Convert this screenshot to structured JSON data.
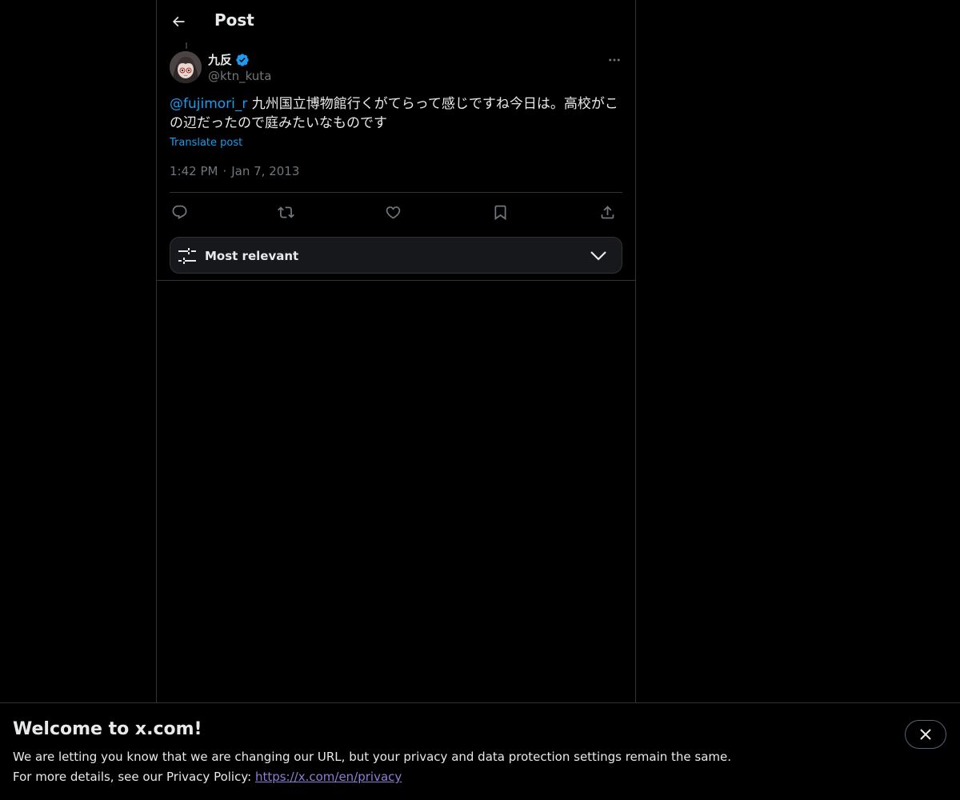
{
  "header": {
    "title": "Post",
    "back_icon": "arrow-left-icon"
  },
  "post": {
    "author": {
      "display_name": "九反",
      "verified": true,
      "handle": "@ktn_kuta"
    },
    "mention": "@fujimori_r",
    "text": " 九州国立博物館行くがてらって感じですね今日は。高校がこの辺だったので庭みたいなものです",
    "translate_label": "Translate post",
    "time": "1:42 PM",
    "separator": "·",
    "date": "Jan 7, 2013",
    "action_icons": [
      "reply-icon",
      "repost-icon",
      "like-icon",
      "bookmark-icon",
      "share-icon"
    ]
  },
  "sort": {
    "label": "Most relevant",
    "icon": "sliders-icon",
    "chevron": "chevron-down-icon"
  },
  "banner": {
    "title": "Welcome to x.com!",
    "line1": "We are letting you know that we are changing our URL, but your privacy and data protection settings remain the same.",
    "line2_prefix": "For more details, see our Privacy Policy: ",
    "link": "https://x.com/en/privacy",
    "close_icon": "close-icon"
  },
  "colors": {
    "accent": "#1d9bf0",
    "background": "#000000",
    "text": "#e7e9ea",
    "muted": "#71767b",
    "border": "#2f3336",
    "link_visited": "#8a7fd4"
  }
}
